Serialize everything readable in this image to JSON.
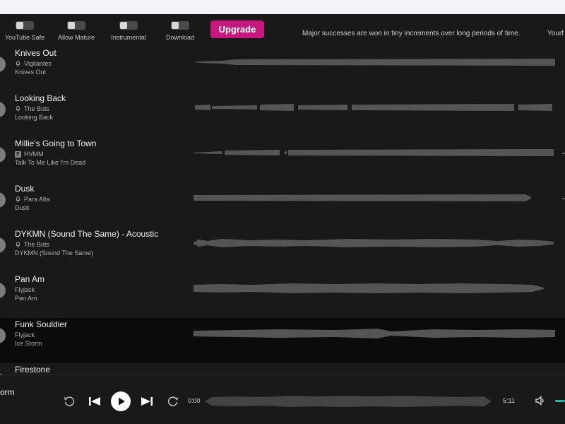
{
  "toolbar": {
    "toggles": [
      {
        "label": "YouTube Safe",
        "on": false
      },
      {
        "label": "Allow Mature",
        "on": false
      },
      {
        "label": "Instrumental",
        "on": false
      },
      {
        "label": "Download",
        "on": false
      }
    ],
    "upgrade_label": "Upgrade",
    "upgrade_color": "#c5197d",
    "quote": "Major successes are won in tiny increments over long periods of time.",
    "quote_next": "Yourf"
  },
  "tracks": [
    {
      "title": "Knives Out",
      "artist": "Vigilantes",
      "album": "Knives Out",
      "artist_icon": "mic-icon"
    },
    {
      "title": "Looking Back",
      "artist": "The Bots",
      "album": "Looking Back",
      "artist_icon": "mic-icon"
    },
    {
      "title": "Millie's Going to Town",
      "artist": "HVMM",
      "album": "Talk To Me Like I'm Dead",
      "artist_icon": "explicit-icon"
    },
    {
      "title": "Dusk",
      "artist": "Para Alta",
      "album": "Dusk",
      "artist_icon": "mic-icon"
    },
    {
      "title": "DYKMN (Sound The Same) - Acoustic",
      "artist": "The Bots",
      "album": "DYKMN (Sound The Same)",
      "artist_icon": "mic-icon"
    },
    {
      "title": "Pan Am",
      "artist": "Flyjack",
      "album": "Pan Am",
      "artist_icon": ""
    },
    {
      "title": "Funk Souldier",
      "artist": "Flyjack",
      "album": "Ice Storm",
      "artist_icon": "",
      "active": true
    },
    {
      "title": "Firestone",
      "artist": "",
      "album": "",
      "artist_icon": ""
    }
  ],
  "player": {
    "now_playing": "orm",
    "current_time": "0:00",
    "duration": "5:11",
    "progress": 0,
    "accent_color": "#1fb8a5"
  }
}
